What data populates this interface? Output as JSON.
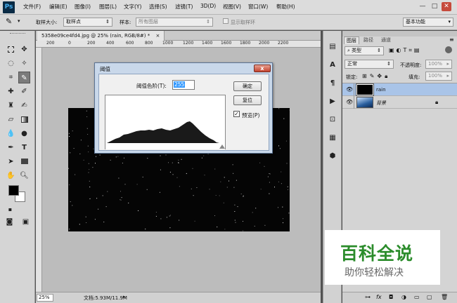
{
  "app": {
    "logo": "Ps"
  },
  "menu": [
    "文件(F)",
    "编辑(E)",
    "图像(I)",
    "图层(L)",
    "文字(Y)",
    "选择(S)",
    "滤镜(T)",
    "3D(D)",
    "视图(V)",
    "窗口(W)",
    "帮助(H)"
  ],
  "window_controls": {
    "minimize": "—",
    "restore": "□",
    "close": "✕"
  },
  "options_bar": {
    "sample_size_label": "取样大小:",
    "sample_size_value": "取样点",
    "sample_label": "样本:",
    "sample_value": "所有图层",
    "show_ring_label": "显示取样环",
    "workspace": "基本功能"
  },
  "document": {
    "tab_title": "5358e09ce4fd4.jpg @ 25% (rain, RGB/8#) *",
    "tab_close": "×",
    "ruler_ticks": [
      "200",
      "0",
      "200",
      "400",
      "600",
      "800",
      "1000",
      "1200",
      "1400",
      "1600",
      "1800",
      "2000",
      "2200"
    ]
  },
  "status": {
    "zoom": "25%",
    "doc_info": "文档:5.93M/11.9M"
  },
  "dialog": {
    "title": "阈值",
    "threshold_label": "阈值色阶(T):",
    "threshold_value": "255",
    "ok_label": "确定",
    "reset_label": "复位",
    "preview_label": "预览(P)",
    "preview_checked": true,
    "close_icon": "x"
  },
  "layers_panel": {
    "tabs": [
      "图层",
      "路径",
      "通道"
    ],
    "kind_filter": "类型",
    "blend_mode": "正常",
    "opacity_label": "不透明度:",
    "opacity_value": "100%",
    "lock_label": "锁定:",
    "fill_label": "填充:",
    "fill_value": "100%",
    "layers": [
      {
        "name": "rain",
        "visible": true,
        "selected": true
      },
      {
        "name": "背景",
        "visible": true,
        "selected": false,
        "locked": true
      }
    ],
    "footer_icons": [
      "link-icon",
      "fx-icon",
      "mask-icon",
      "adjustment-icon",
      "group-icon",
      "new-layer-icon",
      "trash-icon"
    ]
  },
  "watermark": {
    "title": "百科全说",
    "subtitle": "助你轻松解决"
  },
  "colors": {
    "accent": "#3399ff",
    "layer_selected": "#a9c4e8",
    "dialog_frame": "#c9d8ea"
  }
}
